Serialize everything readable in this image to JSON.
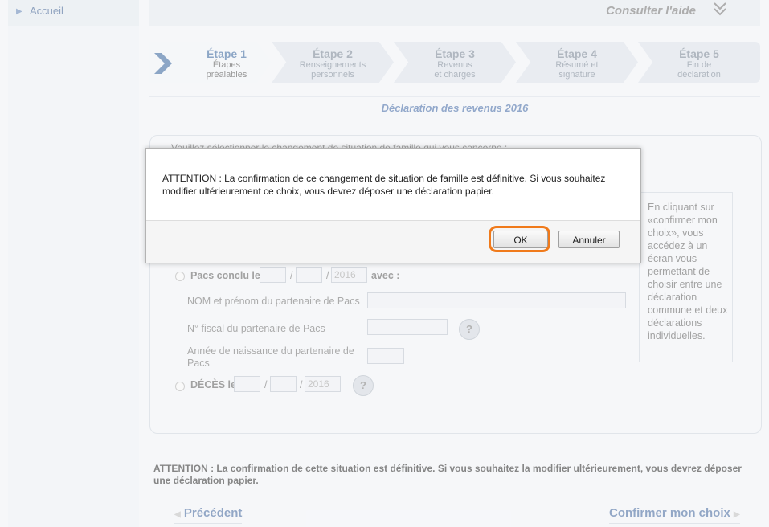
{
  "sidebar": {
    "home_label": "Accueil"
  },
  "header": {
    "help_label": "Consulter l'aide"
  },
  "steps": [
    {
      "title": "Étape 1",
      "sub1": "Étapes",
      "sub2": "préalables"
    },
    {
      "title": "Étape 2",
      "sub1": "Renseignements",
      "sub2": "personnels"
    },
    {
      "title": "Étape 3",
      "sub1": "Revenus",
      "sub2": "et charges"
    },
    {
      "title": "Étape 4",
      "sub1": "Résumé et",
      "sub2": "signature"
    },
    {
      "title": "Étape 5",
      "sub1": "Fin de",
      "sub2": "déclaration"
    }
  ],
  "declaration_title": "Déclaration des revenus 2016",
  "form": {
    "intro": "Veuillez sélectionner le changement de situation de famille qui vous concerne :",
    "pacs_label": "Pacs conclu le",
    "pacs_year": "2016",
    "avec": "avec :",
    "partner_name_label": "NOM et prénom du partenaire de Pacs",
    "partner_fiscal_label": "N° fiscal du partenaire de Pacs",
    "partner_birth_label_1": "Année de naissance du partenaire de",
    "partner_birth_label_2": "Pacs",
    "deces_label": "DÉCÈS le",
    "deces_year": "2016",
    "slash": "/",
    "help_q": "?"
  },
  "sidebox_text": "En cliquant sur «confirmer mon choix», vous accédez à un écran vous permettant de choisir entre une déclaration commune et deux déclarations individuelles.",
  "attention_bottom": "ATTENTION : La confirmation de cette situation est définitive. Si vous souhaitez la modifier ultérieurement, vous devrez déposer une déclaration papier.",
  "nav": {
    "prev": "Précédent",
    "next": "Confirmer mon choix"
  },
  "dialog": {
    "message": "ATTENTION : La confirmation de ce changement de situation de famille est définitive. Si vous souhaitez modifier ultérieurement ce choix, vous devrez déposer une déclaration papier.",
    "ok": "OK",
    "cancel": "Annuler"
  },
  "colors": {
    "accent": "#2e5d98",
    "highlight": "#f07a1b"
  }
}
